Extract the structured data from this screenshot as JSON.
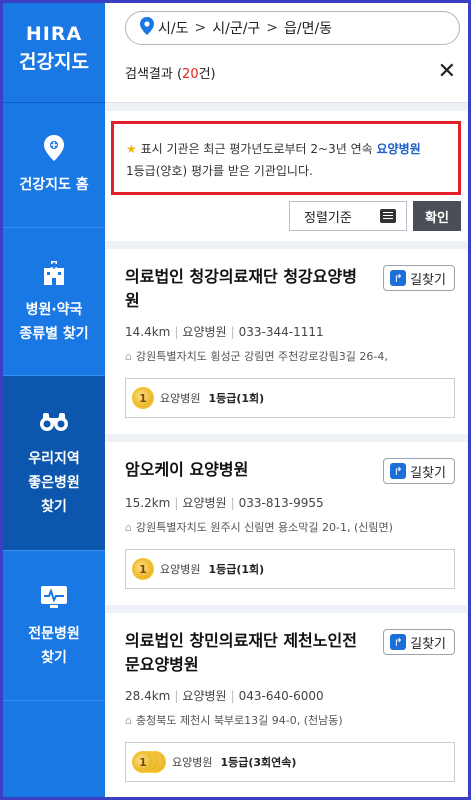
{
  "sidebar": {
    "logo_line1": "HIRA",
    "logo_line2": "건강지도",
    "items": [
      {
        "label": "건강지도 홈",
        "icon": "location-pin-icon"
      },
      {
        "label": "병원·약국\n종류별 찾기",
        "icon": "hospital-building-icon"
      },
      {
        "label": "우리지역\n좋은병원\n찾기",
        "icon": "binoculars-icon"
      },
      {
        "label": "전문병원\n찾기",
        "icon": "monitor-heartbeat-icon"
      }
    ]
  },
  "region": {
    "level1": "시/도",
    "level2": "시/군/구",
    "level3": "읍/면/동"
  },
  "results": {
    "label_prefix": "검색결과 (",
    "count": "20",
    "label_suffix": "건)"
  },
  "notice": {
    "text_before": "표시 기관은 최근 평가년도로부터 2~3년 연속 ",
    "highlight": "요양병원",
    "text_after": "1등급(양호) 평가를 받은 기관입니다."
  },
  "sort": {
    "label": "정렬기준",
    "confirm": "확인"
  },
  "route_label": "길찾기",
  "hospitals": [
    {
      "name": "의료법인 청강의료재단 청강요양병원",
      "distance": "14.4km",
      "type": "요양병원",
      "phone": "033-344-1111",
      "address": "강원특별자치도 횡성군 강림면 주천강로강림3길 26-4,",
      "grade_medal": "1",
      "grade_type": "요양병원",
      "grade": "1등급(1회)",
      "medal_count": 1
    },
    {
      "name": "암오케이 요양병원",
      "distance": "15.2km",
      "type": "요양병원",
      "phone": "033-813-9955",
      "address": "강원특별자치도 원주시 신림면 용소막길 20-1, (신림면)",
      "grade_medal": "1",
      "grade_type": "요양병원",
      "grade": "1등급(1회)",
      "medal_count": 1
    },
    {
      "name": "의료법인 창민의료재단 제천노인전문요양병원",
      "distance": "28.4km",
      "type": "요양병원",
      "phone": "043-640-6000",
      "address": "충청북도 제천시 북부로13길 94-0, (천남동)",
      "grade_medal": "1",
      "grade_type": "요양병원",
      "grade": "1등급(3회연속)",
      "medal_count": 3
    }
  ]
}
